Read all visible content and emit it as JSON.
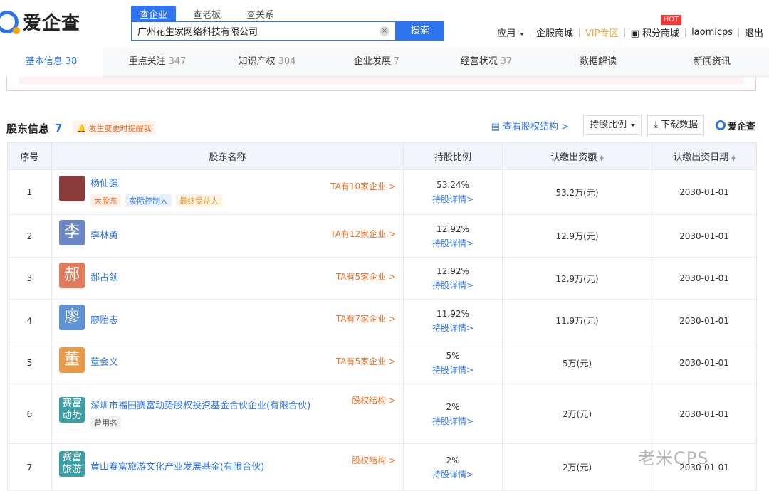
{
  "header": {
    "logo_text": "爱企查",
    "search_tabs": [
      "查企业",
      "查老板",
      "查关系"
    ],
    "search_value": "广州花生家网络科技有限公司",
    "search_button": "搜索",
    "nav": {
      "apps": "应用",
      "mall": "企服商城",
      "vip": "VIP",
      "vip_suffix": "专区",
      "points": "积分商城",
      "hot_badge": "HOT",
      "user": "laomicps",
      "logout": "退出"
    }
  },
  "tabs": [
    {
      "label": "基本信息",
      "count": "38"
    },
    {
      "label": "重点关注",
      "count": "347"
    },
    {
      "label": "知识产权",
      "count": "304"
    },
    {
      "label": "企业发展",
      "count": "7"
    },
    {
      "label": "经营状况",
      "count": "37"
    },
    {
      "label": "数据解读",
      "count": ""
    },
    {
      "label": "新闻资讯",
      "count": ""
    }
  ],
  "section": {
    "title": "股东信息",
    "count": "7",
    "remind": "发生变更时提醒我",
    "view_structure": "查看股权结构 >",
    "ratio_dropdown": "持股比例",
    "download": "下载数据",
    "brand": "爱企查"
  },
  "table": {
    "headers": [
      "序号",
      "股东名称",
      "持股比例",
      "认缴出资额",
      "认缴出资日期"
    ],
    "rows": [
      {
        "idx": "1",
        "name": "杨仙强",
        "avatar": "",
        "avatar_color": "#8b3a3a",
        "tags": [
          {
            "text": "大股东",
            "style": "orange"
          },
          {
            "text": "实际控制人",
            "style": "blue"
          },
          {
            "text": "最终受益人",
            "style": "yellow"
          }
        ],
        "link": "TA有10家企业 >",
        "pct": "53.24%",
        "detail": "持股详情>",
        "amount": "53.2万(元)",
        "date": "2030-01-01"
      },
      {
        "idx": "2",
        "name": "李林勇",
        "avatar": "李",
        "avatar_color": "#6b86c5",
        "tags": [],
        "link": "TA有12家企业 >",
        "pct": "12.92%",
        "detail": "持股详情>",
        "amount": "12.9万(元)",
        "date": "2030-01-01"
      },
      {
        "idx": "3",
        "name": "郝占领",
        "avatar": "郝",
        "avatar_color": "#e07a5a",
        "tags": [],
        "link": "TA有5家企业 >",
        "pct": "12.92%",
        "detail": "持股详情>",
        "amount": "12.9万(元)",
        "date": "2030-01-01"
      },
      {
        "idx": "4",
        "name": "廖贻志",
        "avatar": "廖",
        "avatar_color": "#5d93d6",
        "tags": [],
        "link": "TA有7家企业 >",
        "pct": "11.92%",
        "detail": "持股详情>",
        "amount": "11.9万(元)",
        "date": "2030-01-01"
      },
      {
        "idx": "5",
        "name": "董会义",
        "avatar": "董",
        "avatar_color": "#e89a4b",
        "tags": [],
        "link": "TA有5家企业 >",
        "pct": "5%",
        "detail": "持股详情>",
        "amount": "5万(元)",
        "date": "2030-01-01"
      },
      {
        "idx": "6",
        "name": "深圳市福田赛富动势股权投资基金合伙企业(有限合伙)",
        "avatar": "赛富动势",
        "avatar_color": "#3aa0a8",
        "tags": [
          {
            "text": "曾用名",
            "style": "grey"
          }
        ],
        "link": "股权结构 >",
        "pct": "2%",
        "detail": "持股详情>",
        "amount": "2万(元)",
        "date": "2030-01-01"
      },
      {
        "idx": "7",
        "name": "黄山赛富旅游文化产业发展基金(有限合伙)",
        "avatar": "赛富旅游",
        "avatar_color": "#3aa0a8",
        "tags": [],
        "link": "股权结构 >",
        "pct": "2%",
        "detail": "持股详情>",
        "amount": "2万(元)",
        "date": "2030-01-01"
      }
    ]
  },
  "watermark": "老米CPS"
}
